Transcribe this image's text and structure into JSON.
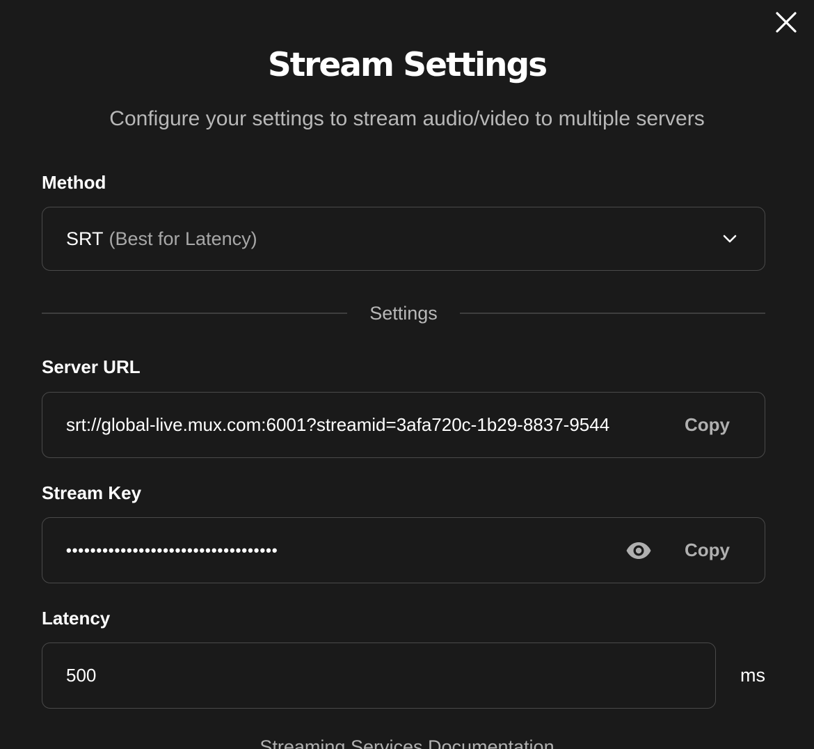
{
  "dialog": {
    "title": "Stream Settings",
    "subtitle": "Configure your settings to stream audio/video to multiple servers",
    "close_icon": "close-icon"
  },
  "method": {
    "label": "Method",
    "selected_value": "SRT",
    "selected_hint": "(Best for Latency)",
    "chevron_icon": "chevron-down-icon"
  },
  "section_divider": {
    "label": "Settings"
  },
  "server_url": {
    "label": "Server URL",
    "value": "srt://global-live.mux.com:6001?streamid=3afa720c-1b29-8837-9544",
    "copy_label": "Copy"
  },
  "stream_key": {
    "label": "Stream Key",
    "masked_value": "•••••••••••••••••••••••••••••••••••",
    "eye_icon": "eye-icon",
    "copy_label": "Copy"
  },
  "latency": {
    "label": "Latency",
    "value": "500",
    "unit": "ms"
  },
  "footer": {
    "doc_link": "Streaming Services Documentation"
  },
  "colors": {
    "background": "#1a1a1a",
    "border": "#4a4a4a",
    "muted_text": "#b8b8b8",
    "text": "#ffffff"
  }
}
